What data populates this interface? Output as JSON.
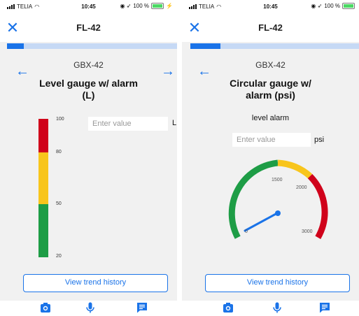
{
  "status_bar": {
    "carrier": "TELIA",
    "time": "10:45",
    "battery": "100 %"
  },
  "screens": [
    {
      "nav_title": "FL-42",
      "progress": 0.1,
      "subtitle": "GBX-42",
      "title_line1": "Level gauge w/ alarm",
      "title_line2": "(L)",
      "input_placeholder": "Enter value",
      "input_value": "",
      "unit": "L",
      "scale_ticks": [
        "100",
        "80",
        "50",
        "20"
      ],
      "level_bands": [
        {
          "from": 80,
          "to": 100,
          "color": "#d0021b"
        },
        {
          "from": 50,
          "to": 80,
          "color": "#f8c51c"
        },
        {
          "from": 20,
          "to": 50,
          "color": "#1e9d46"
        }
      ],
      "trend_button": "View trend history"
    },
    {
      "nav_title": "FL-42",
      "progress": 0.18,
      "subtitle": "GBX-42",
      "title_line1": "Circular gauge w/",
      "title_line2": "alarm (psi)",
      "hint": "level alarm",
      "input_placeholder": "Enter value",
      "input_value": "",
      "unit": "psi",
      "gauge_labels": [
        "1500",
        "2000",
        "3000",
        "0"
      ],
      "gauge_bands": [
        {
          "name": "ok",
          "color": "#1e9d46"
        },
        {
          "name": "warn",
          "color": "#f8c51c"
        },
        {
          "name": "alarm",
          "color": "#d0021b"
        }
      ],
      "trend_button": "View trend history"
    }
  ],
  "icons": {
    "close": "close-icon",
    "back": "arrow-left-icon",
    "forward": "arrow-right-icon",
    "camera": "camera-icon",
    "mic": "microphone-icon",
    "chat": "chat-icon"
  },
  "colors": {
    "accent": "#1a73e8",
    "progress_track": "#c6d9f5"
  }
}
